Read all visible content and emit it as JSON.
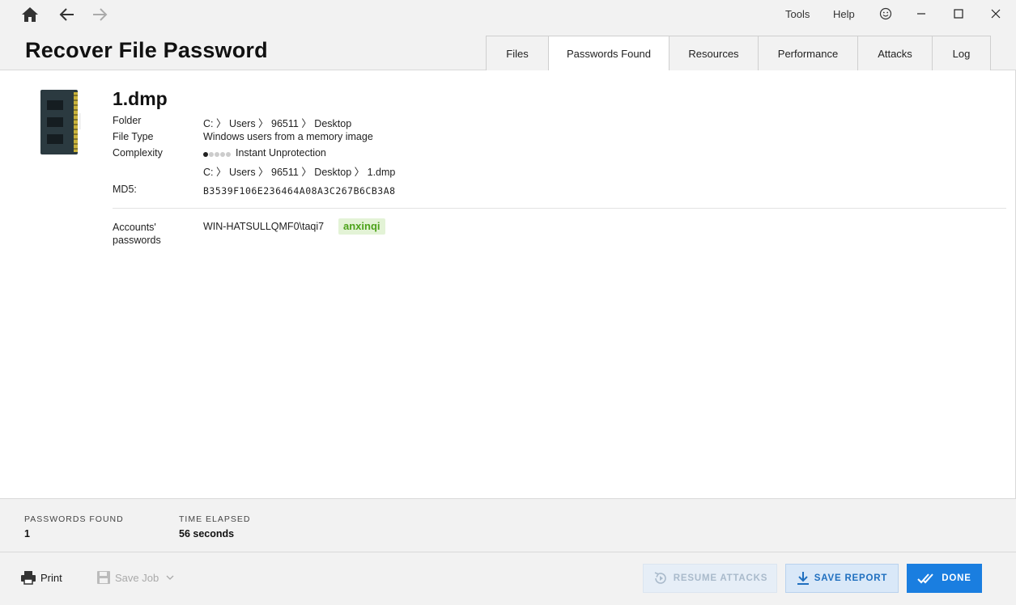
{
  "topbar": {
    "menu": {
      "tools": "Tools",
      "help": "Help"
    },
    "icons": {
      "home": "home-icon",
      "back": "arrow-left-icon",
      "forward": "arrow-right-icon",
      "feedback": "smiley-icon",
      "minimize": "minimize-icon",
      "maximize": "maximize-icon",
      "close": "close-icon"
    }
  },
  "header": {
    "title": "Recover File Password"
  },
  "tabs": [
    {
      "label": "Files"
    },
    {
      "label": "Passwords Found",
      "active": true
    },
    {
      "label": "Resources"
    },
    {
      "label": "Performance"
    },
    {
      "label": "Attacks"
    },
    {
      "label": "Log"
    }
  ],
  "file": {
    "icon": "memory-chip-icon",
    "name": "1.dmp",
    "folder_label": "Folder",
    "folder": "C: 〉 Users 〉 96511 〉 Desktop",
    "type_label": "File Type",
    "type": "Windows users from a memory image",
    "complexity_label": "Complexity",
    "complexity_level": 1,
    "complexity_max": 5,
    "complexity": "Instant Unprotection",
    "path": "C: 〉 Users 〉 96511 〉 Desktop 〉 1.dmp",
    "md5_label": "MD5:",
    "md5": "B3539F106E236464A08A3C267B6CB3A8"
  },
  "accounts": {
    "label": "Accounts' passwords",
    "account": "WIN-HATSULLQMF0\\taqi7",
    "password": "anxinqi",
    "password_color": "#4ca21a"
  },
  "stats": {
    "passwords_found_label": "PASSWORDS FOUND",
    "passwords_found": "1",
    "time_elapsed_label": "TIME ELAPSED",
    "time_elapsed": "56 seconds"
  },
  "footer": {
    "print": "Print",
    "save_job": "Save Job",
    "resume": "RESUME ATTACKS",
    "save_report": "SAVE REPORT",
    "done": "DONE",
    "accent": "#1a7ee0"
  }
}
